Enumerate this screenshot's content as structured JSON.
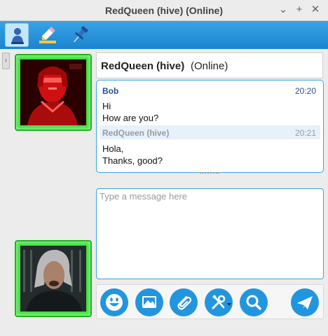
{
  "window": {
    "title": "RedQueen (hive) (Online)",
    "controls": [
      "⌄",
      "+",
      "✕"
    ]
  },
  "toolbar": {
    "items": [
      {
        "name": "contact-info",
        "icon": "person-icon"
      },
      {
        "name": "highlight",
        "icon": "highlighter-icon"
      },
      {
        "name": "pin",
        "icon": "pushpin-icon"
      }
    ]
  },
  "sidebar": {
    "collapse_glyph": "‹"
  },
  "chat": {
    "contact_name": "RedQueen (hive)",
    "contact_status": "(Online)",
    "messages": [
      {
        "sender": "Bob",
        "time": "20:20",
        "lines": [
          "Hi",
          "How are you?"
        ]
      },
      {
        "sender": "RedQueen (hive)",
        "time": "20:21",
        "lines": [
          "Hola,",
          "Thanks, good?"
        ]
      }
    ]
  },
  "input": {
    "placeholder": "Type a message here",
    "value": ""
  },
  "actions": [
    {
      "name": "emoji",
      "icon": "smiley-icon"
    },
    {
      "name": "send-image",
      "icon": "image-icon"
    },
    {
      "name": "attach-file",
      "icon": "paperclip-icon"
    },
    {
      "name": "tools",
      "icon": "wrench-screwdriver-icon"
    },
    {
      "name": "search",
      "icon": "magnifier-icon"
    },
    {
      "name": "send",
      "icon": "paper-plane-icon"
    }
  ],
  "colors": {
    "accent": "#2196df",
    "toolbar_top": "#3aa3e6",
    "avatar_border": "#3fe13f",
    "bob_name": "#2d4f8a",
    "contact_name_gray": "#9a9a9a"
  }
}
